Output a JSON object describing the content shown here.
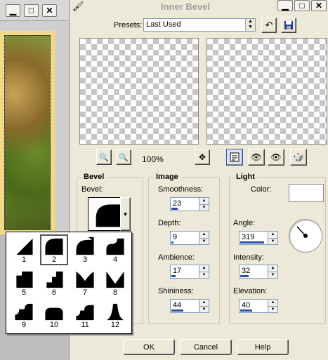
{
  "dialog": {
    "title": "Inner Bevel",
    "presets_label": "Presets:",
    "presets_value": "Last Used",
    "zoom_value": "100%"
  },
  "bevel_group": {
    "title": "Bevel",
    "bevel_label": "Bevel:",
    "shapes": [
      "1",
      "2",
      "3",
      "4",
      "5",
      "6",
      "7",
      "8",
      "9",
      "10",
      "11",
      "12"
    ],
    "selected_shape": "2"
  },
  "image_group": {
    "title": "Image",
    "smoothness_label": "Smoothness:",
    "smoothness": "23",
    "smoothness_level": 0.23,
    "depth_label": "Depth:",
    "depth": "9",
    "depth_level": 0.09,
    "ambience_label": "Ambience:",
    "ambience": "17",
    "ambience_level": 0.17,
    "shininess_label": "Shininess:",
    "shininess": "44",
    "shininess_level": 0.44
  },
  "light_group": {
    "title": "Light",
    "color_label": "Color:",
    "color": "#ffffff",
    "angle_label": "Angle:",
    "angle": "319",
    "angle_level": 0.89,
    "intensity_label": "Intensity:",
    "intensity": "32",
    "intensity_level": 0.32,
    "elevation_label": "Elevation:",
    "elevation": "40",
    "elevation_level": 0.44
  },
  "buttons": {
    "ok": "OK",
    "cancel": "Cancel",
    "help": "Help"
  },
  "colors": {
    "dialog_bg": "#ece9d8",
    "slider_fill": "#2a4ea8"
  }
}
